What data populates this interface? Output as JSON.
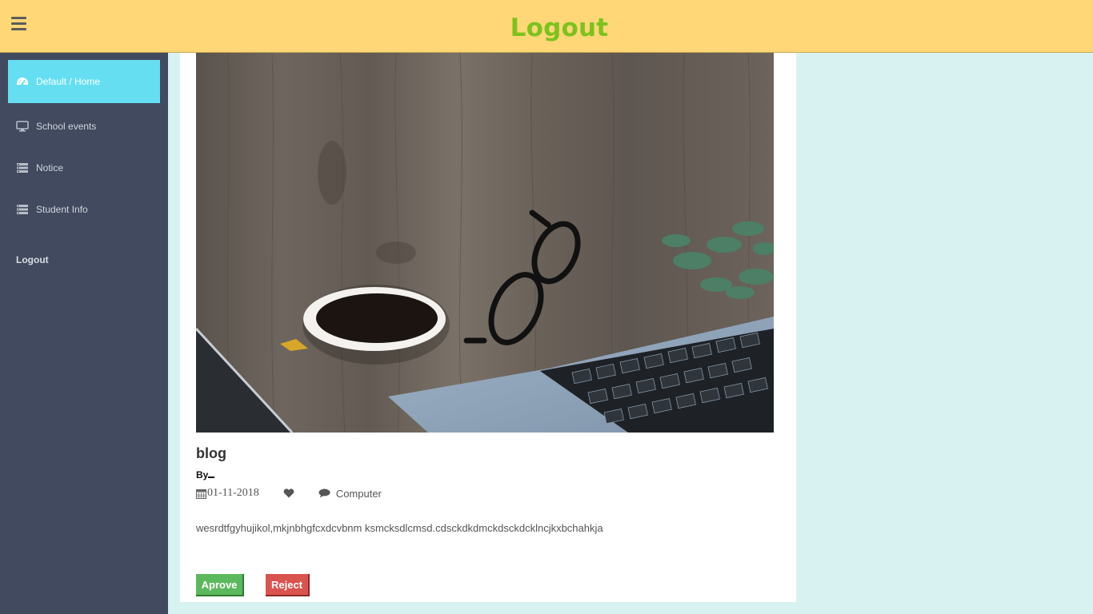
{
  "topbar": {
    "title": "Logout",
    "menu_icon": "hamburger-icon"
  },
  "sidebar": {
    "items": [
      {
        "label": "Default / Home",
        "icon": "dashboard-icon",
        "active": true
      },
      {
        "label": "School events",
        "icon": "desktop-icon",
        "active": false
      },
      {
        "label": "Notice",
        "icon": "list-icon",
        "active": false
      },
      {
        "label": "Student Info",
        "icon": "list-icon",
        "active": false
      }
    ],
    "logout_label": "Logout"
  },
  "post": {
    "title": "blog",
    "by_label": "By",
    "author": "",
    "date": "01-11-2018",
    "category": "Computer",
    "body": "wesrdtfgyhujikol,mkjnbhgfcxdcvbnm ksmcksdlcmsd.cdsckdkdmckdsckdcklncjkxbchahkja",
    "approve_label": "Aprove",
    "reject_label": "Reject"
  },
  "colors": {
    "topbar": "#ffd777",
    "title": "#7cc21e",
    "sidebar": "#414a5e",
    "active_item": "#65def2",
    "page_bg": "#d8f2f1",
    "approve": "#5cb85c",
    "reject": "#d9534f"
  }
}
